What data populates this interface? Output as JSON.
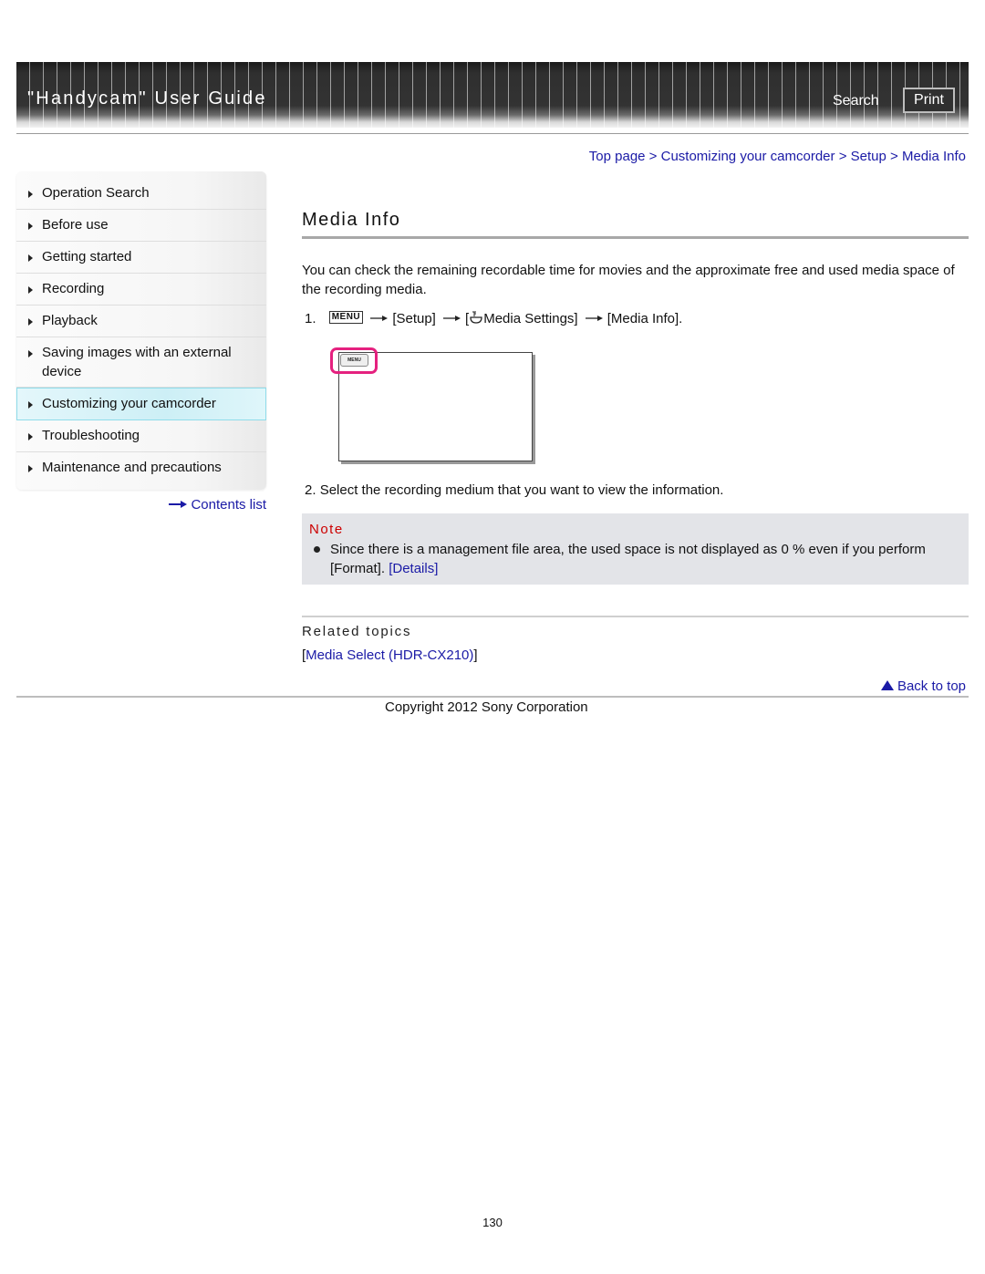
{
  "header": {
    "title": "\"Handycam\" User Guide",
    "search_label": "Search",
    "print_label": "Print"
  },
  "breadcrumb": {
    "items": [
      "Top page",
      "Customizing your camcorder",
      "Setup",
      "Media Info"
    ],
    "separator": " > "
  },
  "sidebar": {
    "items": [
      {
        "label": "Operation Search",
        "active": false
      },
      {
        "label": "Before use",
        "active": false
      },
      {
        "label": "Getting started",
        "active": false
      },
      {
        "label": "Recording",
        "active": false
      },
      {
        "label": "Playback",
        "active": false
      },
      {
        "label": "Saving images with an external device",
        "active": false
      },
      {
        "label": "Customizing your camcorder",
        "active": true
      },
      {
        "label": "Troubleshooting",
        "active": false
      },
      {
        "label": "Maintenance and precautions",
        "active": false
      }
    ],
    "contents_link": "Contents list"
  },
  "main": {
    "title": "Media Info",
    "intro": "You can check the remaining recordable time for movies and the approximate free and used media space of the recording media.",
    "step1": {
      "number": "1.",
      "menu_key": "MENU",
      "setup": "[Setup]",
      "media_settings_open": "[",
      "media_settings": "Media Settings]",
      "media_info": "[Media Info]."
    },
    "illustration": {
      "menu_button_label": "MENU",
      "highlight_color": "#e5217f"
    },
    "step2": {
      "number": "2.",
      "text": "Select the recording medium that you want to view the information."
    },
    "note": {
      "title": "Note",
      "text": "Since there is a management file area, the used space is not displayed as 0 % even if you perform [Format].",
      "details_link": "[Details]",
      "title_color": "#cc0000"
    },
    "related": {
      "title": "Related topics",
      "bracket_open": "[",
      "link": "Media Select (HDR-CX210)",
      "bracket_close": "]"
    },
    "back_to_top": "Back to top"
  },
  "footer": {
    "copyright": "Copyright 2012 Sony Corporation",
    "page_number": "130"
  },
  "colors": {
    "link": "#1a1aa6",
    "note_bg": "#e3e4e8",
    "active_nav_bg": "#cdeff6"
  }
}
